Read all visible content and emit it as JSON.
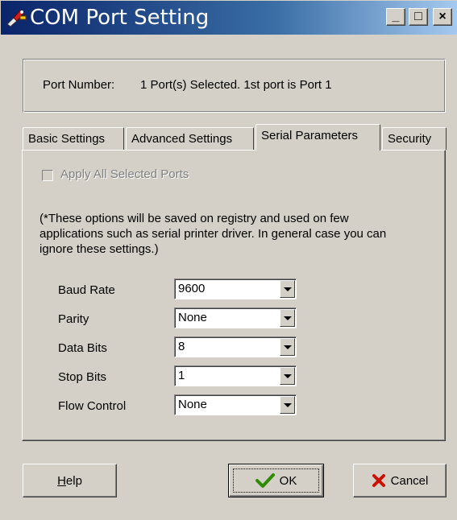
{
  "window": {
    "title": "COM Port Setting",
    "icon": "plug-wrench-icon",
    "controls": {
      "minimize": "_",
      "maximize": "□",
      "close": "×"
    }
  },
  "port": {
    "label": "Port Number:",
    "value": "1 Port(s) Selected. 1st port is Port 1"
  },
  "tabs": [
    {
      "label": "Basic Settings",
      "active": false
    },
    {
      "label": "Advanced Settings",
      "active": false
    },
    {
      "label": "Serial Parameters",
      "active": true
    },
    {
      "label": "Security",
      "active": false
    }
  ],
  "panel": {
    "apply_all": {
      "label": "Apply All Selected Ports",
      "checked": false,
      "enabled": false
    },
    "note": "(*These options will be saved on registry and used on few applications such as serial printer driver. In general case you can ignore these settings.)",
    "fields": [
      {
        "label": "Baud Rate",
        "value": "9600"
      },
      {
        "label": "Parity",
        "value": "None"
      },
      {
        "label": "Data Bits",
        "value": "8"
      },
      {
        "label": "Stop Bits",
        "value": "1"
      },
      {
        "label": "Flow Control",
        "value": "None"
      }
    ]
  },
  "buttons": {
    "help": {
      "label_prefix": "H",
      "label_rest": "elp"
    },
    "ok": {
      "label": "OK",
      "icon": "checkmark-icon"
    },
    "cancel": {
      "label": "Cancel",
      "icon": "x-cross-icon"
    }
  },
  "colors": {
    "titlebar_start": "#0a246a",
    "titlebar_end": "#a6caf0",
    "face": "#d4d0c8",
    "ok_check": "#2e8b00",
    "cancel_x": "#cc1100"
  }
}
